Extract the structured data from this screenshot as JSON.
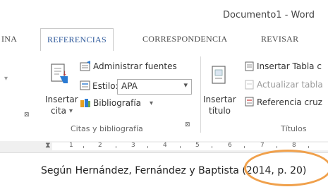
{
  "window": {
    "title": "Documento1 - Word"
  },
  "tabs": [
    {
      "label": "INA"
    },
    {
      "label": "REFERENCIAS"
    },
    {
      "label": "CORRESPONDENCIA"
    },
    {
      "label": "REVISAR"
    }
  ],
  "ribbon": {
    "citations_group": {
      "insert_citation": {
        "line1": "Insertar",
        "line2": "cita",
        "arrow": "▾"
      },
      "manage_sources": "Administrar fuentes",
      "style_label": "Estilo:",
      "style_value": "APA",
      "bibliography": "Bibliografía",
      "group_label": "Citas y bibliografía"
    },
    "captions_group": {
      "insert_caption": {
        "line1": "Insertar",
        "line2": "título"
      },
      "insert_table_of_figures": "Insertar Tabla c",
      "update_table": "Actualizar tabla",
      "cross_reference": "Referencia cruz",
      "group_label": "Títulos"
    }
  },
  "ruler": {
    "numbers": [
      "1",
      "2",
      "3",
      "4",
      "5",
      "6",
      "7",
      "8"
    ]
  },
  "document": {
    "text_before": "Según Hernández, Fernández y Baptista ",
    "citation": "(2014, p. 20)"
  },
  "colors": {
    "accent": "#2b579a",
    "highlight": "#f0a04b"
  }
}
